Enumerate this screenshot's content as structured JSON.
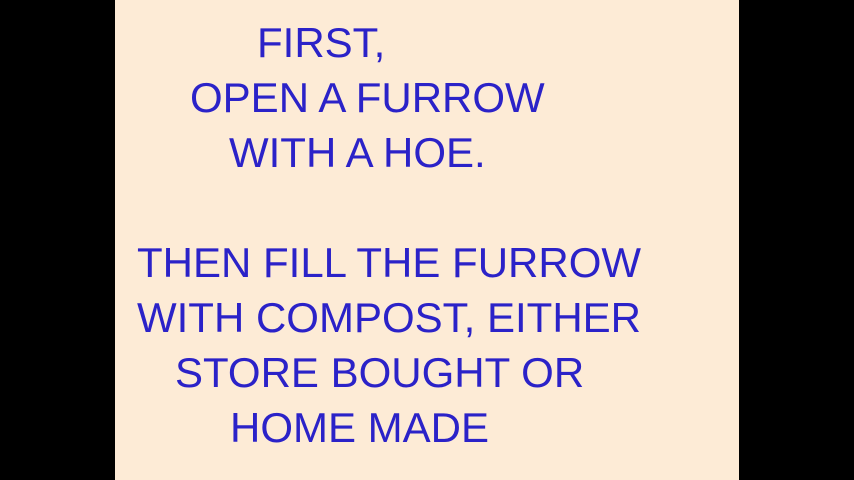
{
  "slide": {
    "lines": [
      "FIRST,",
      "OPEN A FURROW",
      "WITH A HOE.",
      "THEN FILL THE FURROW",
      "WITH COMPOST, EITHER",
      "STORE BOUGHT OR",
      "HOME MADE"
    ]
  },
  "colors": {
    "background": "#fdebd6",
    "text": "#2b22c8",
    "letterbox": "#000000"
  }
}
